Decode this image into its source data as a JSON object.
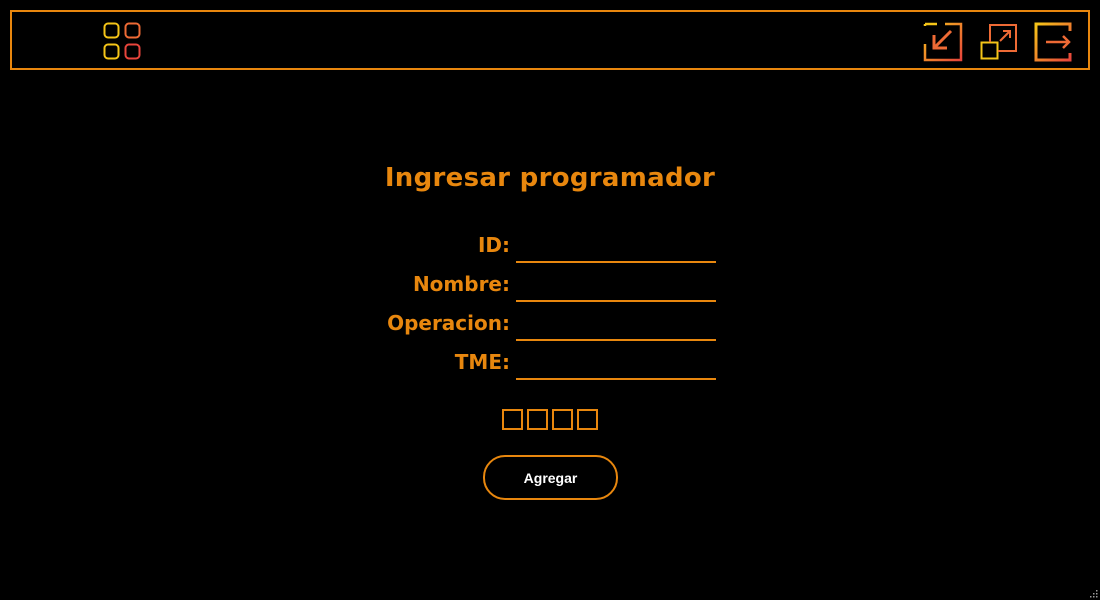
{
  "topbar": {
    "menu_icon": "grid-menu-icon",
    "window_controls": [
      {
        "name": "minimize-icon"
      },
      {
        "name": "maximize-icon"
      },
      {
        "name": "exit-icon"
      }
    ]
  },
  "form": {
    "title": "Ingresar programador",
    "fields": {
      "id": {
        "label": "ID:",
        "value": ""
      },
      "nombre": {
        "label": "Nombre:",
        "value": ""
      },
      "operacion": {
        "label": "Operacion:",
        "value": ""
      },
      "tme": {
        "label": "TME:",
        "value": ""
      }
    },
    "checkbox_count": 4,
    "submit_label": "Agregar"
  },
  "colors": {
    "accent": "#e8870e",
    "gradient_start": "#f5c518",
    "gradient_end": "#e8453c",
    "background": "#000000",
    "button_text": "#ffffff"
  }
}
